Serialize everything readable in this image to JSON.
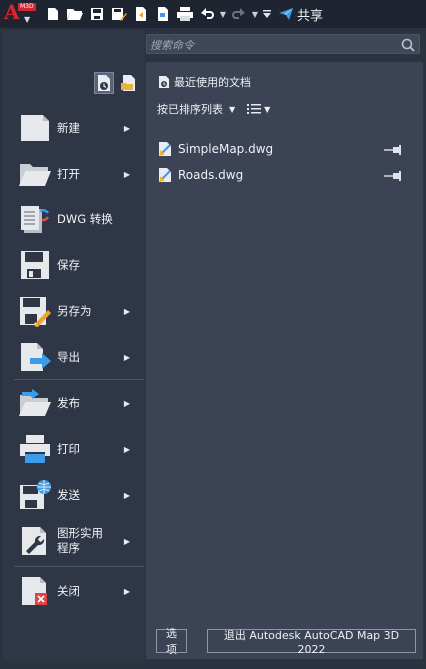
{
  "app": {
    "logo_tag": "M3D"
  },
  "toolbar": {
    "share_label": "共享"
  },
  "search": {
    "placeholder": "搜索命令"
  },
  "menu": {
    "items": [
      {
        "label": "新建",
        "has_submenu": true
      },
      {
        "label": "打开",
        "has_submenu": true
      },
      {
        "label": "DWG 转换",
        "has_submenu": false
      },
      {
        "label": "保存",
        "has_submenu": false
      },
      {
        "label": "另存为",
        "has_submenu": true
      },
      {
        "label": "导出",
        "has_submenu": true
      },
      {
        "label": "发布",
        "has_submenu": true
      },
      {
        "label": "打印",
        "has_submenu": true
      },
      {
        "label": "发送",
        "has_submenu": true
      },
      {
        "label": "图形实用程序",
        "line1": "图形实用",
        "line2": "程序",
        "has_submenu": true
      },
      {
        "label": "关闭",
        "has_submenu": true
      }
    ]
  },
  "recent": {
    "title": "最近使用的文档",
    "sort_label": "按已排序列表",
    "files": [
      {
        "name": "SimpleMap.dwg"
      },
      {
        "name": "Roads.dwg"
      }
    ]
  },
  "footer": {
    "options_label": "选项",
    "exit_label": "退出 Autodesk AutoCAD Map 3D 2022"
  },
  "colors": {
    "logo_red": "#d7262d",
    "background": "#2b3240",
    "panel": "#3b4354",
    "accent_blue": "#3d9be9"
  }
}
